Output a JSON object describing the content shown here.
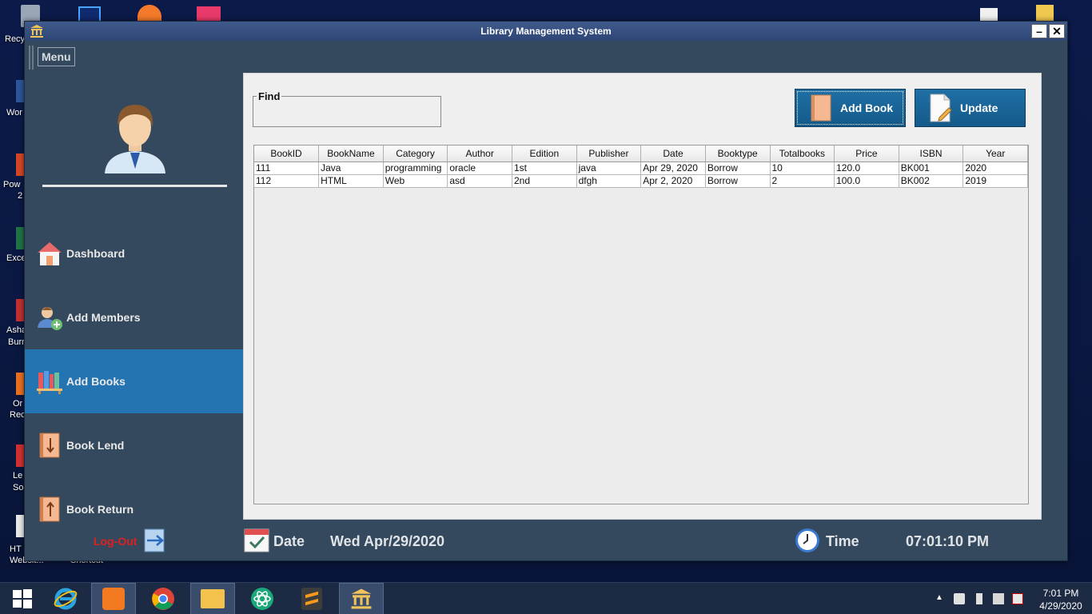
{
  "desktop": {
    "labels": [
      "Recy",
      "Wor",
      "Pow",
      "2",
      "Exce",
      "Asha",
      "Burn",
      "Or",
      "Rec",
      "Le",
      "So",
      "HT",
      "Websit..."
    ],
    "shortcut_label": "Shortcut"
  },
  "window": {
    "title": "Library Management System",
    "minimize": "–",
    "close": "✕"
  },
  "menu": {
    "label": "Menu"
  },
  "sidebar": {
    "items": [
      {
        "label": "Dashboard",
        "icon": "house-icon"
      },
      {
        "label": "Add Members",
        "icon": "add-member-icon"
      },
      {
        "label": "Add Books",
        "icon": "books-shelf-icon",
        "active": true
      },
      {
        "label": "Book Lend",
        "icon": "book-lend-icon"
      },
      {
        "label": "Book Return",
        "icon": "book-return-icon"
      }
    ],
    "logout": "Log-Out"
  },
  "find": {
    "legend": "Find",
    "value": ""
  },
  "buttons": {
    "add_book": "Add Book",
    "update": "Update"
  },
  "table": {
    "columns": [
      "BookID",
      "BookName",
      "Category",
      "Author",
      "Edition",
      "Publisher",
      "Date",
      "Booktype",
      "Totalbooks",
      "Price",
      "ISBN",
      "Year"
    ],
    "rows": [
      [
        "111",
        "Java",
        "programming",
        "oracle",
        "1st",
        "java",
        "Apr 29, 2020",
        "Borrow",
        "10",
        "120.0",
        "BK001",
        "2020"
      ],
      [
        "112",
        "HTML",
        "Web",
        "asd",
        "2nd",
        "dfgh",
        "Apr 2, 2020",
        "Borrow",
        "2",
        "100.0",
        "BK002",
        "2019"
      ]
    ]
  },
  "footer": {
    "date_label": "Date",
    "date_value": "Wed Apr/29/2020",
    "time_label": "Time",
    "time_value": "07:01:10 PM"
  },
  "taskbar": {
    "time": "7:01 PM",
    "date": "4/29/2020"
  },
  "colors": {
    "window_bg": "#34495e",
    "active_nav": "#2374b0",
    "button_blue": "#1f6fa5",
    "logout_red": "#e0201e"
  }
}
